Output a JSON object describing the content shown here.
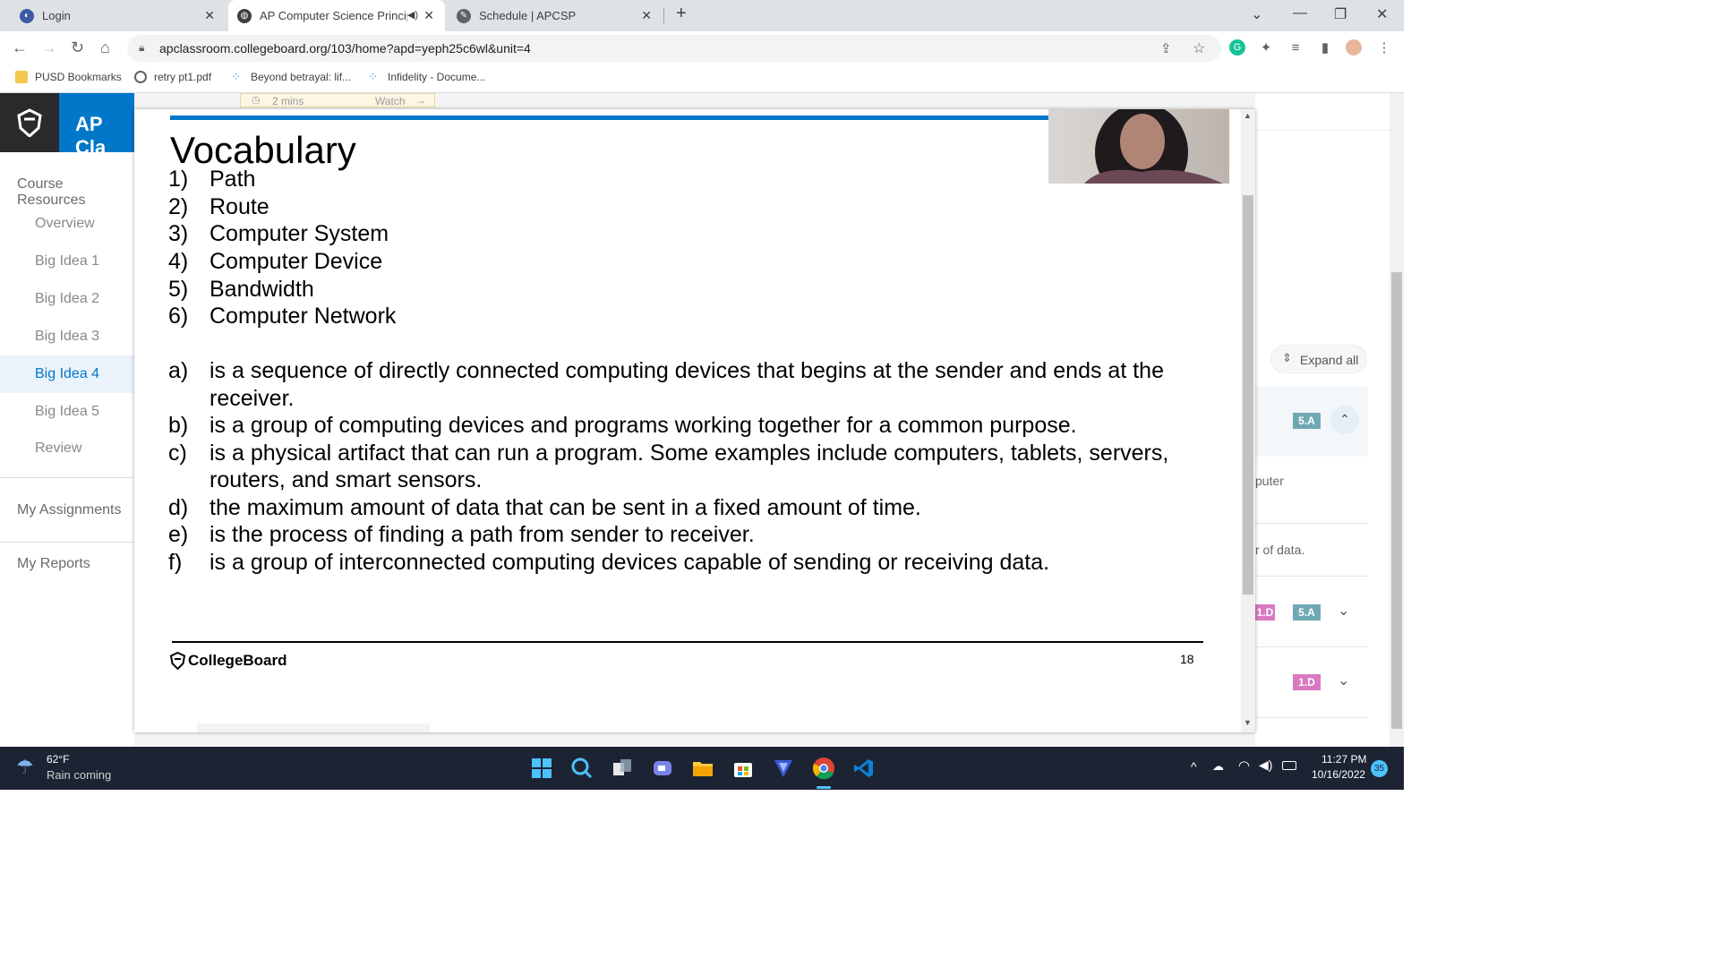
{
  "browser": {
    "tabs": [
      {
        "title": "Login"
      },
      {
        "title": "AP Computer Science Princip"
      },
      {
        "title": "Schedule | APCSP"
      }
    ],
    "url": "apclassroom.collegeboard.org/103/home?apd=yeph25c6wl&unit=4",
    "bookmarks": [
      "PUSD Bookmarks",
      "retry pt1.pdf",
      "Beyond betrayal: lif...",
      "Infidelity - Docume..."
    ]
  },
  "page": {
    "header_text": "AP Cla",
    "video_strip": {
      "duration": "2 mins",
      "watch_label": "Watch"
    },
    "nav": {
      "course_resources": "Course Resources",
      "items": [
        "Overview",
        "Big Idea 1",
        "Big Idea 2",
        "Big Idea 3",
        "Big Idea 4",
        "Big Idea 5",
        "Review"
      ],
      "active_item": "Big Idea 4",
      "my_assignments": "My Assignments",
      "my_reports": "My Reports"
    },
    "right": {
      "expand_all": "Expand all",
      "badge_5a": "5.A",
      "badge_1d": "1.D",
      "badge_1d_partial": "1.D",
      "frag_puter": "puter",
      "frag_data": "r of data."
    }
  },
  "slide": {
    "title": "Vocabulary",
    "terms": [
      {
        "num": "1)",
        "text": "Path"
      },
      {
        "num": "2)",
        "text": "Route"
      },
      {
        "num": "3)",
        "text": "Computer System"
      },
      {
        "num": "4)",
        "text": "Computer Device"
      },
      {
        "num": "5)",
        "text": "Bandwidth"
      },
      {
        "num": "6)",
        "text": "Computer Network"
      }
    ],
    "definitions": {
      "a_num": "a)",
      "a1": "is a sequence of directly connected computing devices that begins at the sender and ends at the",
      "a2": "receiver.",
      "b_num": "b)",
      "b1": "is a group of computing devices and programs working together for a common purpose.",
      "c_num": "c)",
      "c1": "is a physical artifact that can run a program. Some examples include computers, tablets, servers,",
      "c2": "routers, and smart sensors.",
      "d_num": "d)",
      "d1": "the maximum amount of data that can be sent in a fixed amount of time.",
      "e_num": "e)",
      "e1": "is the process of finding a path from sender to receiver.",
      "f_num": "f)",
      "f1": "is a group of interconnected computing devices capable of sending or receiving data."
    },
    "footer_logo": "CollegeBoard",
    "page_number": "18"
  },
  "taskbar": {
    "weather_temp": "62°F",
    "weather_desc": "Rain coming",
    "time": "11:27 PM",
    "date": "10/16/2022",
    "notification_count": "35"
  },
  "colors": {
    "accent": "#0077c8",
    "badge_teal": "#6fa8b3",
    "badge_pink": "#d879c2",
    "taskbar": "#1c2333"
  }
}
